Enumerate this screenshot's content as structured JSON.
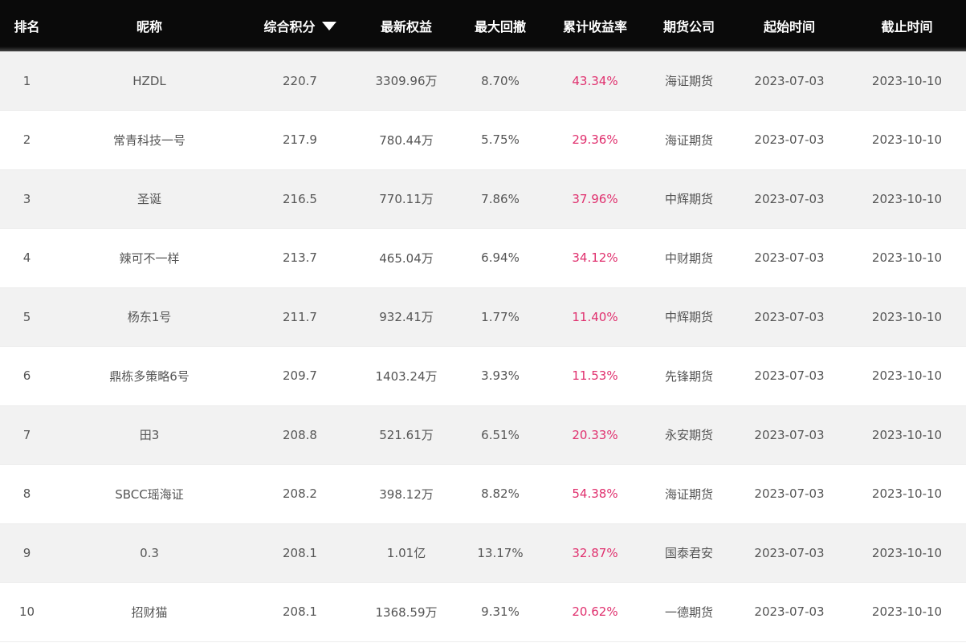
{
  "table": {
    "headers": {
      "rank": "排名",
      "nickname": "昵称",
      "score": "综合积分",
      "equity": "最新权益",
      "drawdown": "最大回撤",
      "cum_return": "累计收益率",
      "broker": "期货公司",
      "start": "起始时间",
      "end": "截止时间"
    },
    "sort": {
      "column": "score",
      "direction": "desc",
      "icon": "caret-down-icon"
    },
    "colors": {
      "header_bg": "#0a0a0a",
      "header_text": "#ffffff",
      "row_alt_bg": "#f2f2f2",
      "text": "#555555",
      "return_color": "#e0306e"
    },
    "rows": [
      {
        "rank": "1",
        "nickname": "HZDL",
        "score": "220.7",
        "equity": "3309.96万",
        "drawdown": "8.70%",
        "cum_return": "43.34%",
        "broker": "海证期货",
        "start": "2023-07-03",
        "end": "2023-10-10"
      },
      {
        "rank": "2",
        "nickname": "常青科技一号",
        "score": "217.9",
        "equity": "780.44万",
        "drawdown": "5.75%",
        "cum_return": "29.36%",
        "broker": "海证期货",
        "start": "2023-07-03",
        "end": "2023-10-10"
      },
      {
        "rank": "3",
        "nickname": "圣诞",
        "score": "216.5",
        "equity": "770.11万",
        "drawdown": "7.86%",
        "cum_return": "37.96%",
        "broker": "中辉期货",
        "start": "2023-07-03",
        "end": "2023-10-10"
      },
      {
        "rank": "4",
        "nickname": "辣可不一样",
        "score": "213.7",
        "equity": "465.04万",
        "drawdown": "6.94%",
        "cum_return": "34.12%",
        "broker": "中财期货",
        "start": "2023-07-03",
        "end": "2023-10-10"
      },
      {
        "rank": "5",
        "nickname": "杨东1号",
        "score": "211.7",
        "equity": "932.41万",
        "drawdown": "1.77%",
        "cum_return": "11.40%",
        "broker": "中辉期货",
        "start": "2023-07-03",
        "end": "2023-10-10"
      },
      {
        "rank": "6",
        "nickname": "鼎栋多策略6号",
        "score": "209.7",
        "equity": "1403.24万",
        "drawdown": "3.93%",
        "cum_return": "11.53%",
        "broker": "先锋期货",
        "start": "2023-07-03",
        "end": "2023-10-10"
      },
      {
        "rank": "7",
        "nickname": "田3",
        "score": "208.8",
        "equity": "521.61万",
        "drawdown": "6.51%",
        "cum_return": "20.33%",
        "broker": "永安期货",
        "start": "2023-07-03",
        "end": "2023-10-10"
      },
      {
        "rank": "8",
        "nickname": "SBCC瑶海证",
        "score": "208.2",
        "equity": "398.12万",
        "drawdown": "8.82%",
        "cum_return": "54.38%",
        "broker": "海证期货",
        "start": "2023-07-03",
        "end": "2023-10-10"
      },
      {
        "rank": "9",
        "nickname": "0.3",
        "score": "208.1",
        "equity": "1.01亿",
        "drawdown": "13.17%",
        "cum_return": "32.87%",
        "broker": "国泰君安",
        "start": "2023-07-03",
        "end": "2023-10-10"
      },
      {
        "rank": "10",
        "nickname": "招财猫",
        "score": "208.1",
        "equity": "1368.59万",
        "drawdown": "9.31%",
        "cum_return": "20.62%",
        "broker": "一德期货",
        "start": "2023-07-03",
        "end": "2023-10-10"
      }
    ]
  }
}
